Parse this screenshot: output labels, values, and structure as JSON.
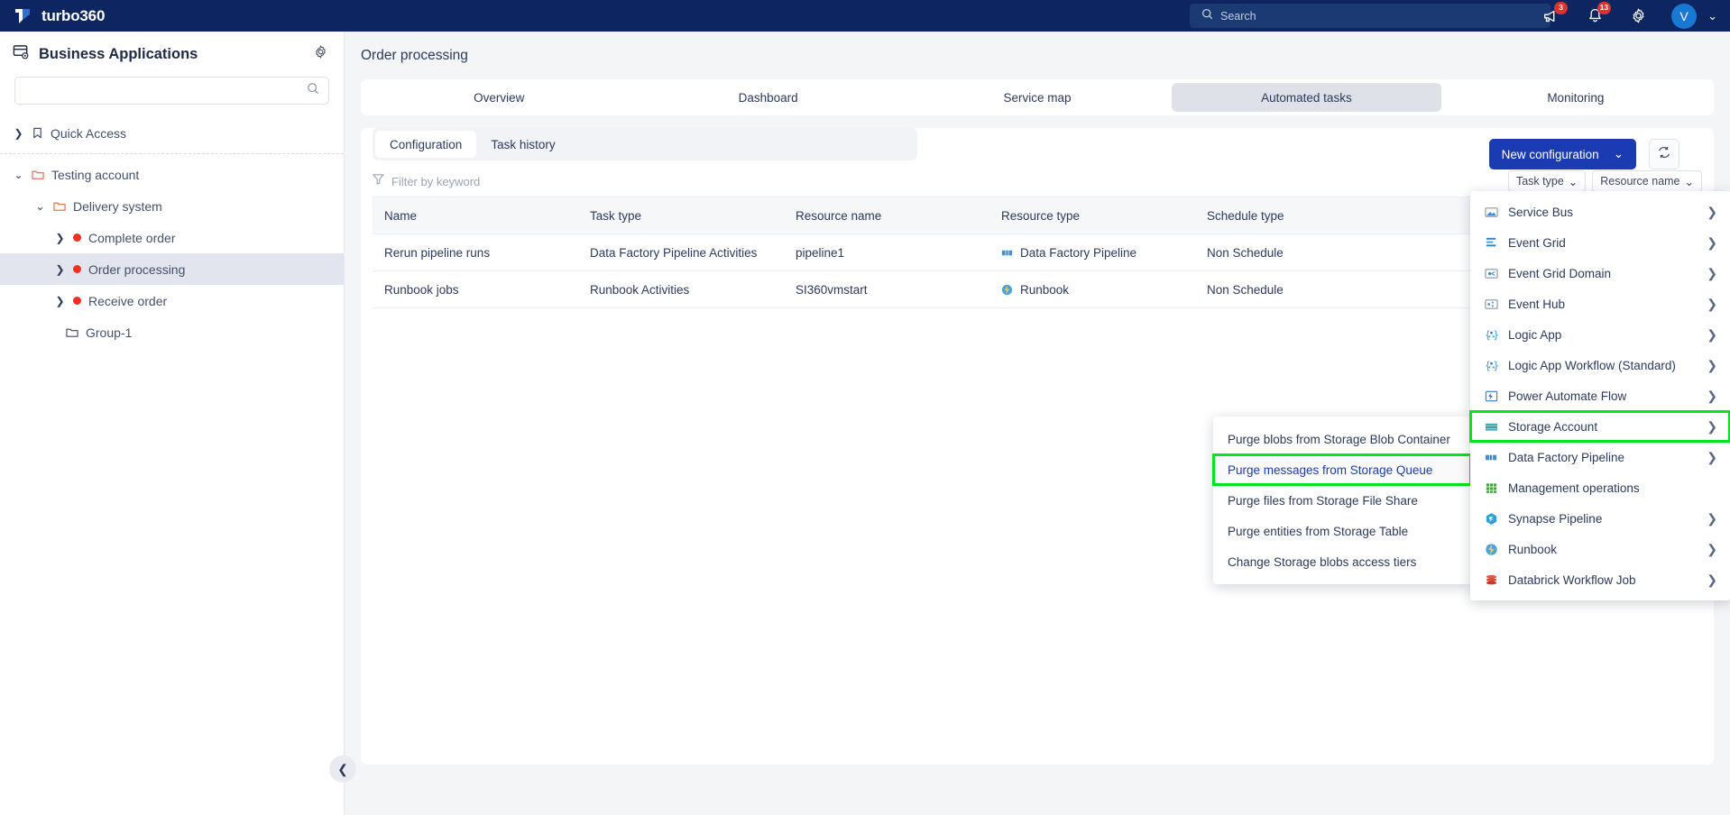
{
  "header": {
    "brand": "turbo360",
    "search_placeholder": "Search",
    "announce_badge": "3",
    "bell_badge": "13",
    "avatar_initial": "V"
  },
  "sidebar": {
    "title": "Business Applications",
    "search_value": "",
    "tree": [
      {
        "label": "Quick Access",
        "icon": "bookmark-icon",
        "indent": 0,
        "caret": "right",
        "selected": false,
        "type": "bookmark"
      },
      {
        "label": "Testing account",
        "icon": "folder-icon",
        "indent": 0,
        "caret": "down",
        "selected": false,
        "type": "folder"
      },
      {
        "label": "Delivery system",
        "icon": "folder-icon",
        "indent": 1,
        "caret": "down",
        "selected": false,
        "type": "folder"
      },
      {
        "label": "Complete order",
        "icon": "status-dot",
        "indent": 2,
        "caret": "right",
        "selected": false,
        "type": "app"
      },
      {
        "label": "Order processing",
        "icon": "status-dot",
        "indent": 2,
        "caret": "right",
        "selected": true,
        "type": "app"
      },
      {
        "label": "Receive order",
        "icon": "status-dot",
        "indent": 2,
        "caret": "right",
        "selected": false,
        "type": "app"
      },
      {
        "label": "Group-1",
        "icon": "folder-icon",
        "indent": 3,
        "caret": "none",
        "selected": false,
        "type": "group"
      }
    ]
  },
  "main": {
    "page_title": "Order processing",
    "tabs": [
      {
        "label": "Overview",
        "active": false
      },
      {
        "label": "Dashboard",
        "active": false
      },
      {
        "label": "Service map",
        "active": false
      },
      {
        "label": "Automated tasks",
        "active": true
      },
      {
        "label": "Monitoring",
        "active": false
      }
    ],
    "subtabs": [
      {
        "label": "Configuration",
        "active": true
      },
      {
        "label": "Task history",
        "active": false
      }
    ],
    "filter": {
      "placeholder": "Filter by keyword",
      "value": "",
      "pills": [
        {
          "label": "Task type"
        },
        {
          "label": "Resource name"
        }
      ]
    },
    "new_configuration_label": "New configuration",
    "table": {
      "columns": [
        "Name",
        "Task type",
        "Resource name",
        "Resource type",
        "Schedule type"
      ],
      "rows": [
        {
          "name": "Rerun pipeline runs",
          "task_type": "Data Factory Pipeline Activities",
          "resource_name": "pipeline1",
          "resource_type": "Data Factory Pipeline",
          "resource_type_icon": "data-factory-pipeline-icon",
          "schedule_type": "Non Schedule"
        },
        {
          "name": "Runbook jobs",
          "task_type": "Runbook Activities",
          "resource_name": "SI360vmstart",
          "resource_type": "Runbook",
          "resource_type_icon": "runbook-icon",
          "schedule_type": "Non Schedule"
        }
      ]
    }
  },
  "menu": {
    "items": [
      {
        "label": "Service Bus",
        "icon": "service-bus-icon",
        "arrow": true,
        "highlighted": false
      },
      {
        "label": "Event Grid",
        "icon": "event-grid-icon",
        "arrow": true,
        "highlighted": false
      },
      {
        "label": "Event Grid Domain",
        "icon": "event-grid-domain-icon",
        "arrow": true,
        "highlighted": false
      },
      {
        "label": "Event Hub",
        "icon": "event-hub-icon",
        "arrow": true,
        "highlighted": false
      },
      {
        "label": "Logic App",
        "icon": "logic-app-icon",
        "arrow": true,
        "highlighted": false
      },
      {
        "label": "Logic App Workflow (Standard)",
        "icon": "logic-app-workflow-icon",
        "arrow": true,
        "highlighted": false
      },
      {
        "label": "Power Automate Flow",
        "icon": "power-automate-flow-icon",
        "arrow": true,
        "highlighted": false
      },
      {
        "label": "Storage Account",
        "icon": "storage-account-icon",
        "arrow": true,
        "highlighted": true
      },
      {
        "label": "Data Factory Pipeline",
        "icon": "data-factory-pipeline-icon",
        "arrow": true,
        "highlighted": false
      },
      {
        "label": "Management operations",
        "icon": "management-operations-icon",
        "arrow": false,
        "highlighted": false
      },
      {
        "label": "Synapse Pipeline",
        "icon": "synapse-pipeline-icon",
        "arrow": true,
        "highlighted": false
      },
      {
        "label": "Runbook",
        "icon": "runbook-icon",
        "arrow": true,
        "highlighted": false
      },
      {
        "label": "Databrick Workflow Job",
        "icon": "databricks-icon",
        "arrow": true,
        "highlighted": false
      }
    ]
  },
  "submenu": {
    "items": [
      {
        "label": "Purge blobs from Storage Blob Container",
        "highlighted": false
      },
      {
        "label": "Purge messages from Storage Queue",
        "highlighted": true
      },
      {
        "label": "Purge files from Storage File Share",
        "highlighted": false
      },
      {
        "label": "Purge entities from Storage Table",
        "highlighted": false
      },
      {
        "label": "Change Storage blobs access tiers",
        "highlighted": false
      }
    ]
  },
  "colors": {
    "brand_navy": "#0d2560",
    "accent_blue": "#1b3bb3",
    "highlight_green": "#00e61a",
    "status_red": "#ef2f24"
  }
}
